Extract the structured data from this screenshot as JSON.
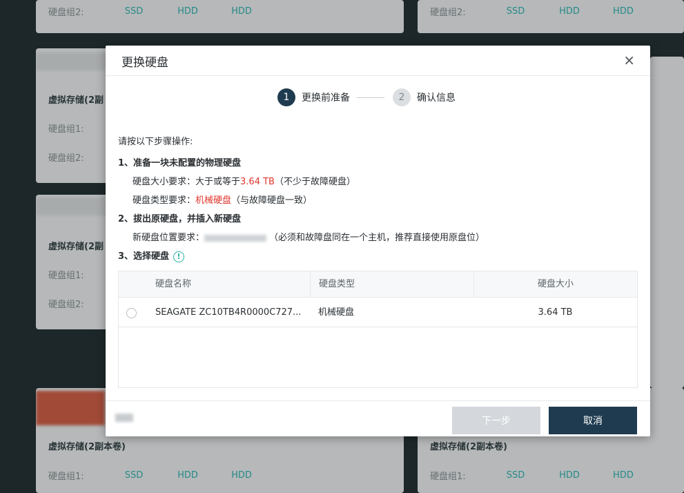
{
  "background": {
    "cards": [
      {
        "title": "",
        "rows": [
          {
            "label": "硬盘组2:",
            "pills": [
              "SSD",
              "HDD",
              "HDD"
            ]
          }
        ]
      },
      {
        "title": "",
        "rows": [
          {
            "label": "硬盘组2:",
            "pills": [
              "SSD",
              "HDD",
              "HDD"
            ]
          }
        ]
      },
      {
        "title": "虚拟存储(2副",
        "rows": [
          {
            "label": "硬盘组1:",
            "pills": []
          },
          {
            "label": "硬盘组2:",
            "pills": []
          }
        ]
      },
      {
        "title": "虚拟存储(2副",
        "rows": [
          {
            "label": "硬盘组1:",
            "pills": []
          },
          {
            "label": "硬盘组2:",
            "pills": []
          }
        ]
      },
      {
        "title": "虚拟存储(2副本卷)",
        "rows": [
          {
            "label": "硬盘组1:",
            "pills": [
              "SSD",
              "HDD",
              "HDD"
            ]
          }
        ]
      },
      {
        "title": "虚拟存储(2副本卷)",
        "rows": [
          {
            "label": "硬盘组1:",
            "pills": [
              "SSD",
              "HDD",
              "HDD"
            ]
          }
        ]
      }
    ]
  },
  "dialog": {
    "title": "更换硬盘",
    "close_glyph": "×",
    "steps": [
      {
        "number": "1",
        "label": "更换前准备",
        "active": true
      },
      {
        "number": "2",
        "label": "确认信息",
        "active": false
      }
    ],
    "intro": "请按以下步骤操作:",
    "step1_heading": "1、准备一块未配置的物理硬盘",
    "size_req_prefix": "硬盘大小要求：大于或等于",
    "size_req_value": "3.64 TB",
    "size_req_suffix": "（不少于故障硬盘）",
    "type_req_prefix": "硬盘类型要求：",
    "type_req_value": "机械硬盘",
    "type_req_suffix": "（与故障硬盘一致）",
    "step2_heading": "2、拔出原硬盘，并插入新硬盘",
    "location_req_prefix": "新硬盘位置要求：",
    "location_req_suffix": "（必须和故障盘同在一个主机，推荐直接使用原盘位）",
    "step3_heading": "3、选择硬盘",
    "info_glyph": "!",
    "table": {
      "headers": [
        "硬盘名称",
        "硬盘类型",
        "硬盘大小"
      ],
      "rows": [
        {
          "name": "SEAGATE ZC10TB4R0000C727...",
          "type": "机械硬盘",
          "size": "3.64 TB"
        }
      ]
    },
    "buttons": {
      "next": "下一步",
      "cancel": "取消"
    }
  },
  "colors": {
    "accent": "#1f3b50",
    "danger": "#e0352b",
    "teal": "#28b0a8"
  }
}
